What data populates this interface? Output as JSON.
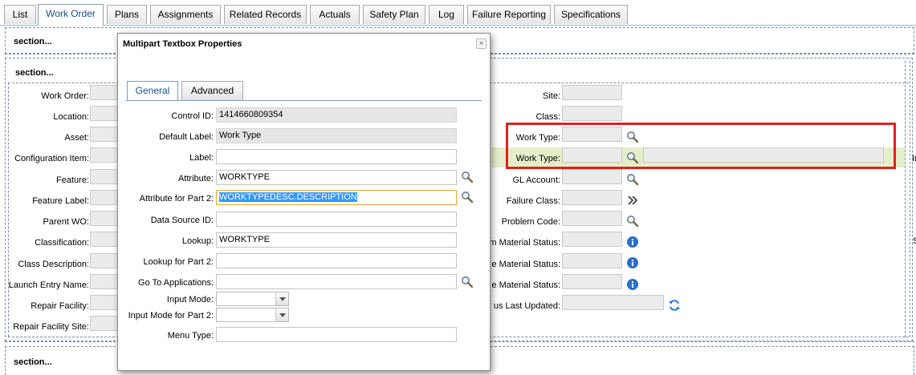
{
  "tabs": [
    "List",
    "Work Order",
    "Plans",
    "Assignments",
    "Related Records",
    "Actuals",
    "Safety Plan",
    "Log",
    "Failure Reporting",
    "Specifications"
  ],
  "section_titles": [
    "section...",
    "section...",
    "section..."
  ],
  "left_fields": [
    "Work Order:",
    "Location:",
    "Asset:",
    "Configuration Item:",
    "Feature:",
    "Feature Label:",
    "Parent WO:",
    "Classification:",
    "Class Description:",
    "Launch Entry Name:",
    "Repair Facility:",
    "Repair Facility Site:"
  ],
  "right_fields": [
    "Site:",
    "Class:",
    "Work Type:",
    "Work Type:",
    "GL Account:",
    "Failure Class:",
    "Problem Code:",
    "m Material Status:",
    "e Material Status:",
    "e Material Status:",
    "us Last Updated:"
  ],
  "dialog": {
    "title": "Multipart Textbox Properties",
    "close": "×",
    "tabs": [
      "General",
      "Advanced"
    ],
    "fields": [
      {
        "label": "Control ID:",
        "value": ""
      },
      {
        "label": "Default Label:",
        "value": "Work Type"
      },
      {
        "label": "Label:",
        "value": ""
      },
      {
        "label": "Attribute:",
        "value": "WORKTYPE"
      },
      {
        "label": "Attribute for Part 2:",
        "value": "WORKTYPEDESC.DESCRIPTION"
      },
      {
        "label": "Data Source ID:",
        "value": ""
      },
      {
        "label": "Lookup:",
        "value": "WORKTYPE"
      },
      {
        "label": "Lookup for Part 2:",
        "value": ""
      },
      {
        "label": "Go To Applications:",
        "value": ""
      },
      {
        "label": "Input Mode:",
        "value": ""
      },
      {
        "label": "Input Mode for Part 2:",
        "value": ""
      },
      {
        "label": "Menu Type:",
        "value": ""
      }
    ],
    "control_id_value": "1414660809354"
  },
  "right_edge": {
    "text1": "In",
    "text2": "S"
  },
  "colors": {
    "highlight_row": "#e4eec9",
    "red_box": "#e0201e",
    "tab_active_text": "#1a4f85",
    "info_icon": "#2a6fc9"
  }
}
